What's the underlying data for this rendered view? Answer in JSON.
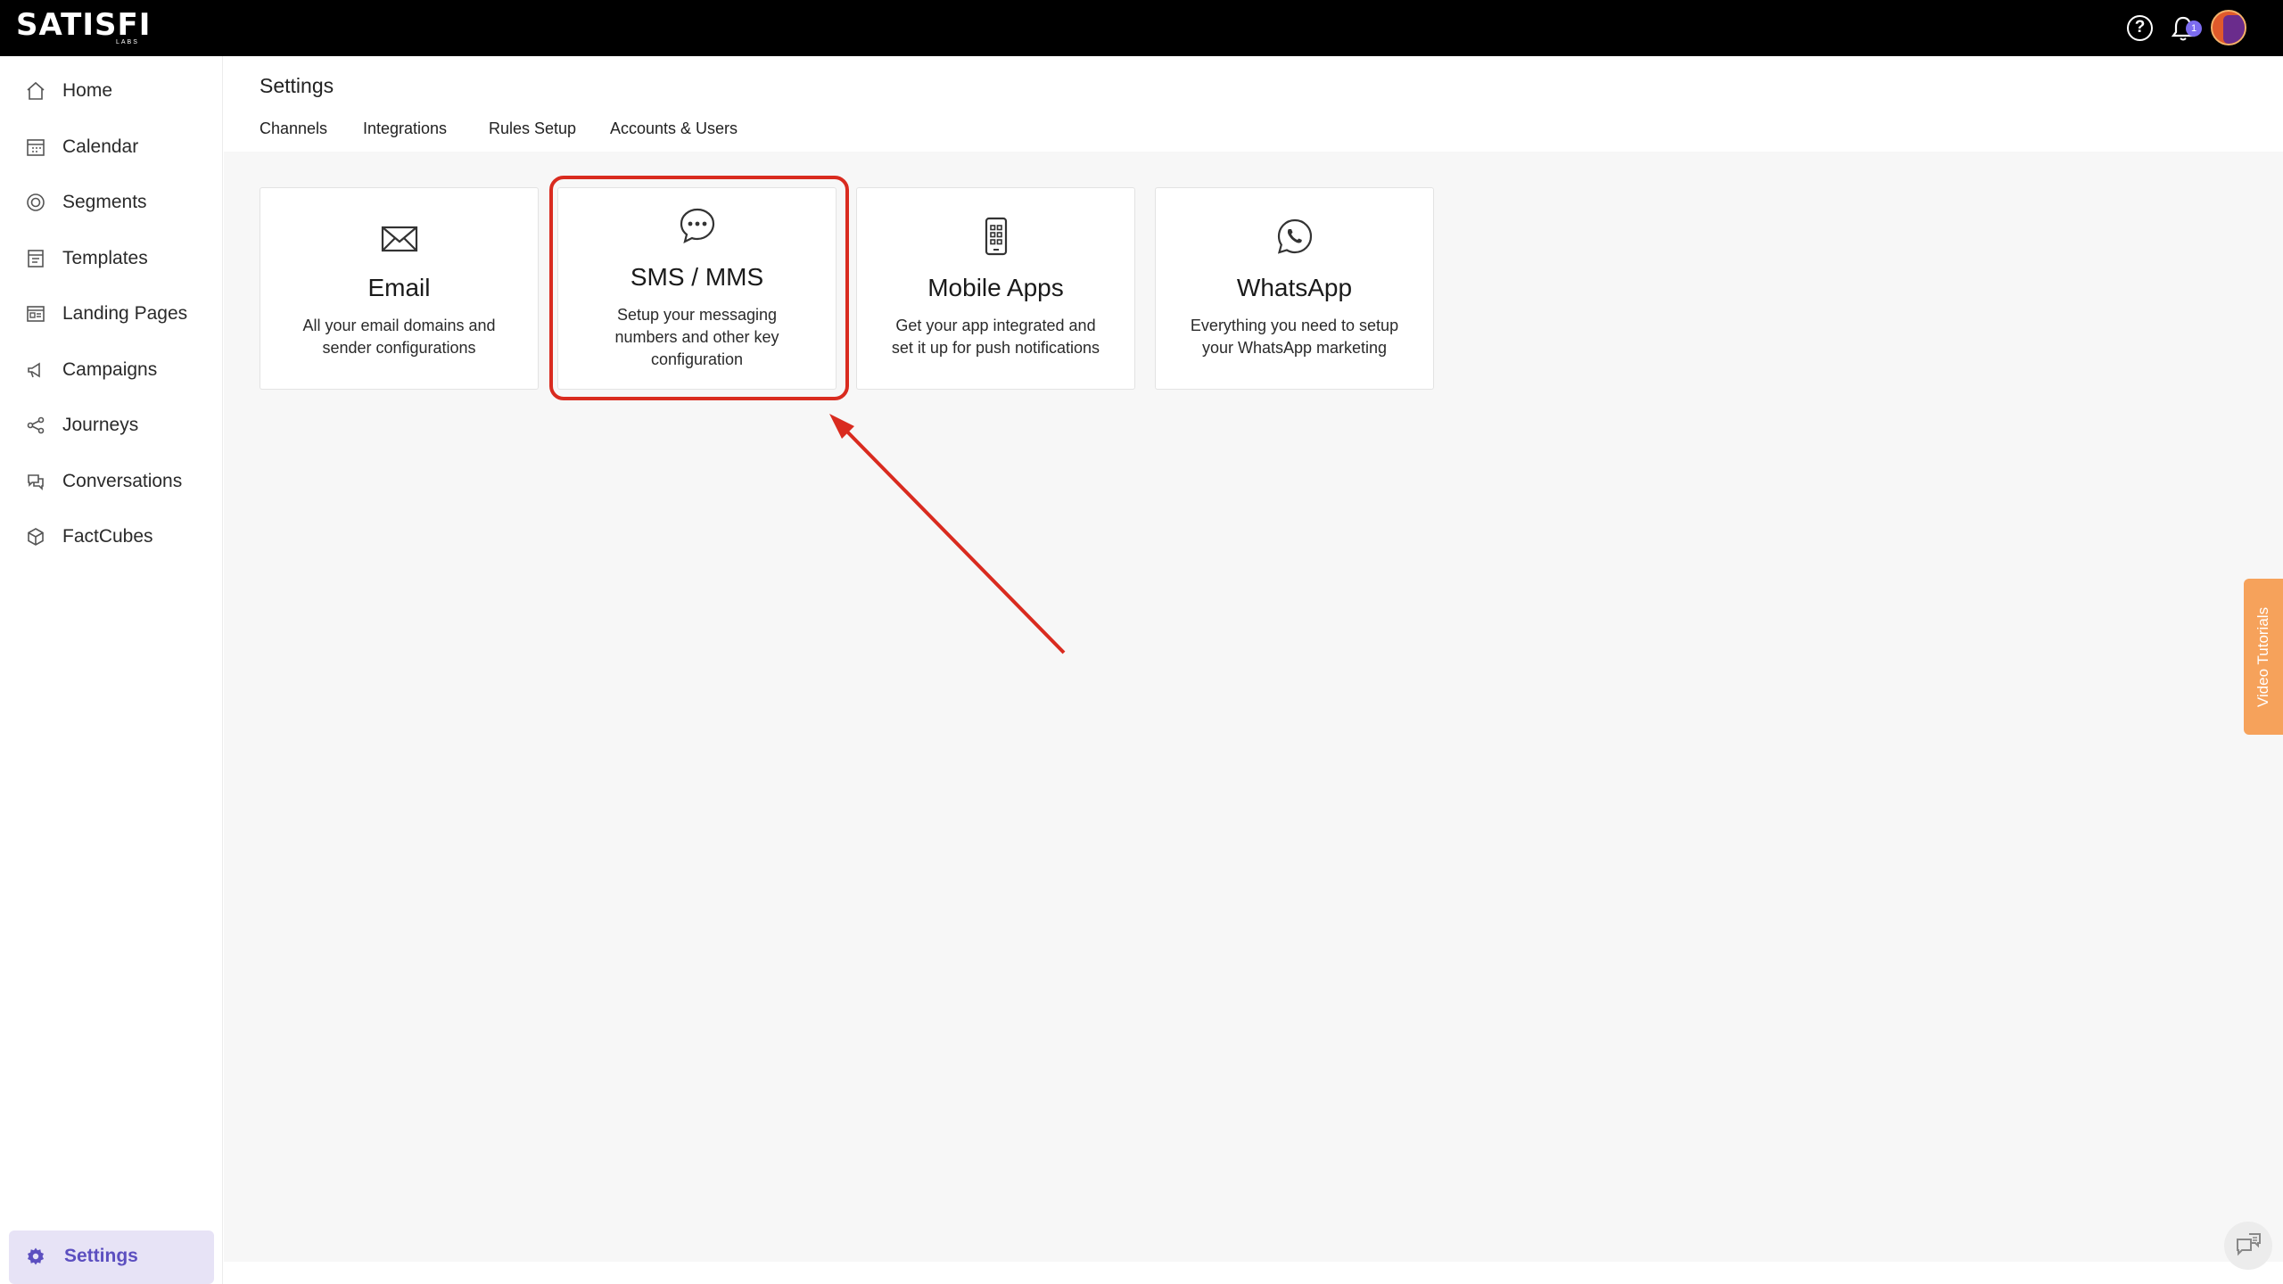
{
  "app": {
    "brand_logo": "SATISFI",
    "brand_sub": "LABS",
    "notification_count": "1",
    "icons": [
      "help-icon",
      "bell-icon",
      "user-avatar"
    ]
  },
  "sidebar": {
    "items": [
      {
        "label": "Home",
        "icon": "home-icon"
      },
      {
        "label": "Calendar",
        "icon": "calendar-icon"
      },
      {
        "label": "Segments",
        "icon": "segments-icon"
      },
      {
        "label": "Templates",
        "icon": "templates-icon"
      },
      {
        "label": "Landing Pages",
        "icon": "landing-pages-icon"
      },
      {
        "label": "Campaigns",
        "icon": "megaphone-icon"
      },
      {
        "label": "Journeys",
        "icon": "share-icon"
      },
      {
        "label": "Conversations",
        "icon": "conversations-icon"
      },
      {
        "label": "FactCubes",
        "icon": "cube-icon"
      }
    ],
    "settings_label": "Settings"
  },
  "page": {
    "title": "Settings",
    "tabs": [
      "Channels",
      "Integrations",
      "Rules Setup",
      "Accounts & Users"
    ]
  },
  "cards": [
    {
      "title": "Email",
      "description": "All your email domains and sender configurations",
      "icon": "envelope-icon"
    },
    {
      "title": "SMS / MMS",
      "description": "Setup your messaging numbers and other key configuration",
      "icon": "chat-bubble-icon"
    },
    {
      "title": "Mobile Apps",
      "description": "Get your app integrated and set it up for push notifications",
      "icon": "mobile-app-icon"
    },
    {
      "title": "WhatsApp",
      "description": "Everything you need to setup your WhatsApp marketing",
      "icon": "whatsapp-icon"
    }
  ],
  "video_tutorials_label": "Video Tutorials",
  "colors": {
    "accent": "#5c4fc0",
    "highlight": "#d92b1f",
    "tutorial_tab": "#f6a25b"
  }
}
